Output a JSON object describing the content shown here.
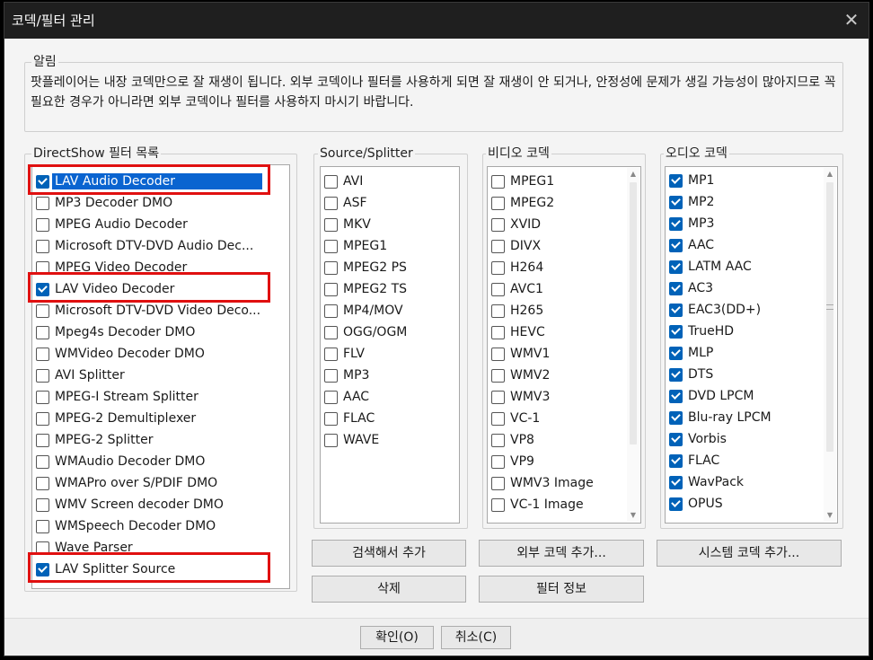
{
  "window": {
    "title": "코덱/필터 관리",
    "close_glyph": "✕"
  },
  "notice": {
    "label": "알림",
    "text": "팟플레이어는 내장 코덱만으로 잘 재생이 됩니다. 외부 코덱이나 필터를 사용하게 되면 잘 재생이 안 되거나, 안정성에 문제가 생길 가능성이 많아지므로 꼭 필요한 경우가 아니라면 외부 코덱이나 필터를 사용하지 마시기 바랍니다."
  },
  "filters": {
    "label": "DirectShow 필터 목록",
    "items": [
      {
        "label": "LAV Audio Decoder",
        "checked": true,
        "selected": true,
        "highlighted": true
      },
      {
        "label": "MP3 Decoder DMO",
        "checked": false
      },
      {
        "label": "MPEG Audio Decoder",
        "checked": false
      },
      {
        "label": "Microsoft DTV-DVD Audio Dec...",
        "checked": false
      },
      {
        "label": "MPEG Video Decoder",
        "checked": false
      },
      {
        "label": "LAV Video Decoder",
        "checked": true,
        "highlighted": true
      },
      {
        "label": "Microsoft DTV-DVD Video Deco...",
        "checked": false
      },
      {
        "label": "Mpeg4s Decoder DMO",
        "checked": false
      },
      {
        "label": "WMVideo Decoder DMO",
        "checked": false
      },
      {
        "label": "AVI Splitter",
        "checked": false
      },
      {
        "label": "MPEG-I Stream Splitter",
        "checked": false
      },
      {
        "label": "MPEG-2 Demultiplexer",
        "checked": false
      },
      {
        "label": "MPEG-2 Splitter",
        "checked": false
      },
      {
        "label": "WMAudio Decoder DMO",
        "checked": false
      },
      {
        "label": "WMAPro over S/PDIF DMO",
        "checked": false
      },
      {
        "label": "WMV Screen decoder DMO",
        "checked": false
      },
      {
        "label": "WMSpeech Decoder DMO",
        "checked": false
      },
      {
        "label": "Wave Parser",
        "checked": false
      },
      {
        "label": "LAV Splitter Source",
        "checked": true,
        "highlighted": true
      }
    ]
  },
  "splitter": {
    "label": "Source/Splitter",
    "items": [
      {
        "label": "AVI",
        "checked": false
      },
      {
        "label": "ASF",
        "checked": false
      },
      {
        "label": "MKV",
        "checked": false
      },
      {
        "label": "MPEG1",
        "checked": false
      },
      {
        "label": "MPEG2 PS",
        "checked": false
      },
      {
        "label": "MPEG2 TS",
        "checked": false
      },
      {
        "label": "MP4/MOV",
        "checked": false
      },
      {
        "label": "OGG/OGM",
        "checked": false
      },
      {
        "label": "FLV",
        "checked": false
      },
      {
        "label": "MP3",
        "checked": false
      },
      {
        "label": "AAC",
        "checked": false
      },
      {
        "label": "FLAC",
        "checked": false
      },
      {
        "label": "WAVE",
        "checked": false
      }
    ]
  },
  "video": {
    "label": "비디오 코덱",
    "items": [
      {
        "label": "MPEG1",
        "checked": false
      },
      {
        "label": "MPEG2",
        "checked": false
      },
      {
        "label": "XVID",
        "checked": false
      },
      {
        "label": "DIVX",
        "checked": false
      },
      {
        "label": "H264",
        "checked": false
      },
      {
        "label": "AVC1",
        "checked": false
      },
      {
        "label": "H265",
        "checked": false
      },
      {
        "label": "HEVC",
        "checked": false
      },
      {
        "label": "WMV1",
        "checked": false
      },
      {
        "label": "WMV2",
        "checked": false
      },
      {
        "label": "WMV3",
        "checked": false
      },
      {
        "label": "VC-1",
        "checked": false
      },
      {
        "label": "VP8",
        "checked": false
      },
      {
        "label": "VP9",
        "checked": false
      },
      {
        "label": "WMV3 Image",
        "checked": false
      },
      {
        "label": "VC-1 Image",
        "checked": false
      }
    ]
  },
  "audio": {
    "label": "오디오 코덱",
    "items": [
      {
        "label": "MP1",
        "checked": true
      },
      {
        "label": "MP2",
        "checked": true
      },
      {
        "label": "MP3",
        "checked": true
      },
      {
        "label": "AAC",
        "checked": true
      },
      {
        "label": "LATM AAC",
        "checked": true
      },
      {
        "label": "AC3",
        "checked": true
      },
      {
        "label": "EAC3(DD+)",
        "checked": true
      },
      {
        "label": "TrueHD",
        "checked": true
      },
      {
        "label": "MLP",
        "checked": true
      },
      {
        "label": "DTS",
        "checked": true
      },
      {
        "label": "DVD LPCM",
        "checked": true
      },
      {
        "label": "Blu-ray LPCM",
        "checked": true
      },
      {
        "label": "Vorbis",
        "checked": true
      },
      {
        "label": "FLAC",
        "checked": true
      },
      {
        "label": "WavPack",
        "checked": true
      },
      {
        "label": "OPUS",
        "checked": true
      }
    ]
  },
  "buttons": {
    "search_add": "검색해서 추가",
    "external_add": "외부 코덱 추가...",
    "system_add": "시스템 코덱 추가...",
    "delete": "삭제",
    "filter_info": "필터 정보",
    "ok": "확인(O)",
    "cancel": "취소(C)"
  },
  "colors": {
    "checked": "#0062b8",
    "selection": "#0a64d0",
    "highlight": "#e01010"
  }
}
